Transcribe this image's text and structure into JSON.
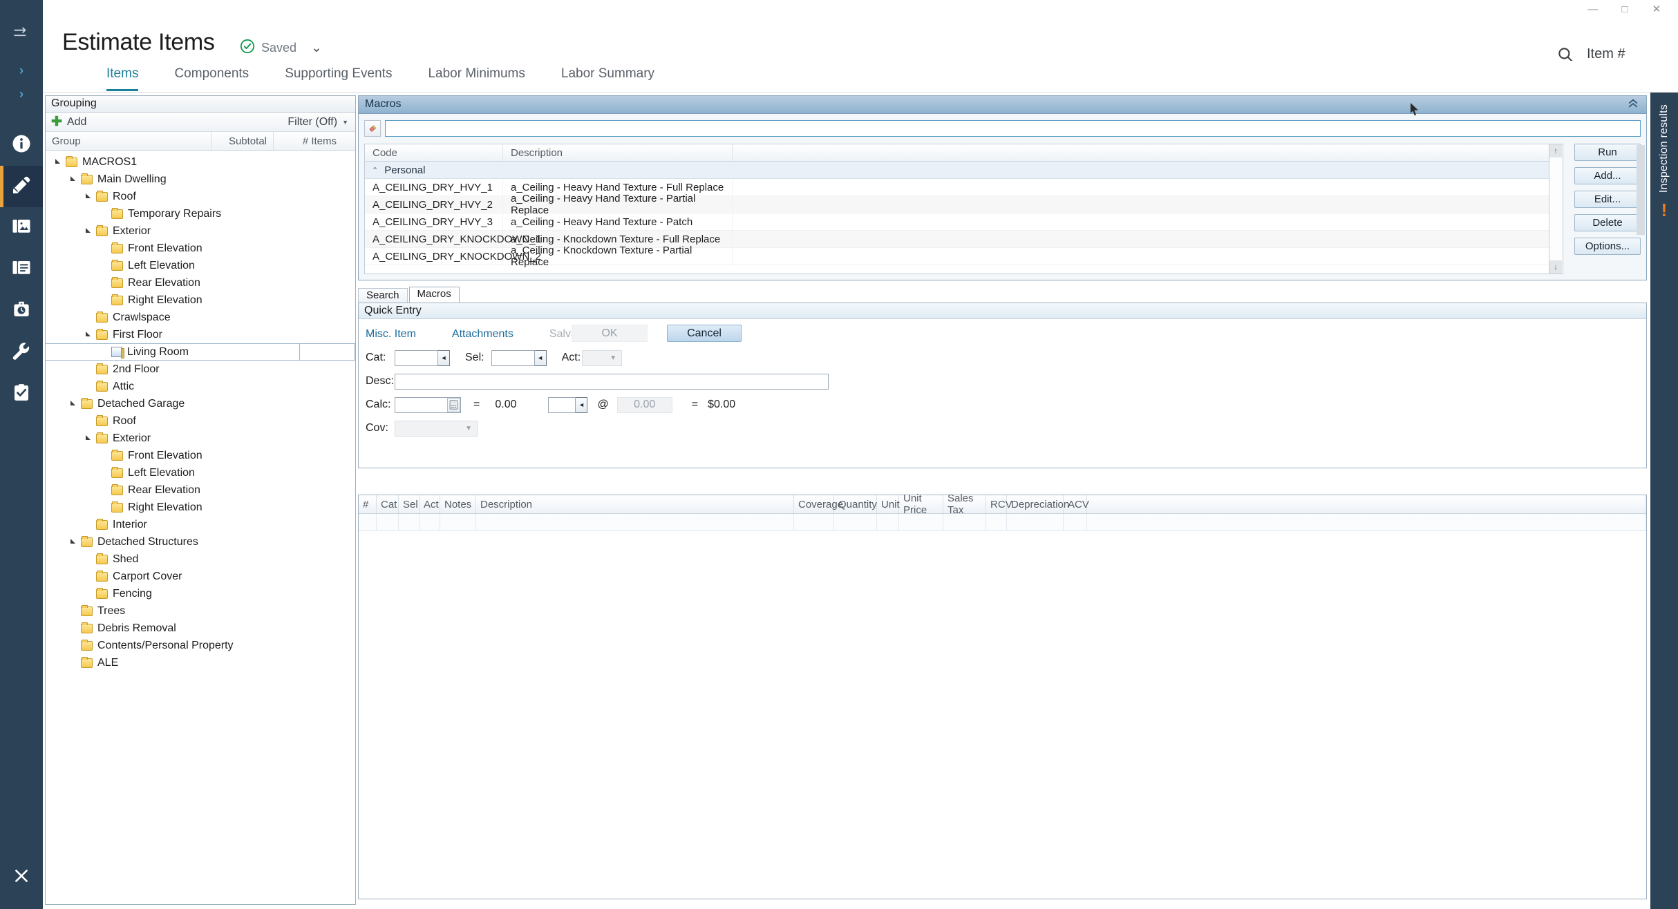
{
  "window": {
    "minimize": "—",
    "maximize": "□",
    "close": "✕"
  },
  "header": {
    "title": "Estimate Items",
    "saved_label": "Saved",
    "saved_icon": "check-circle-icon",
    "saved_chevron": "⌄",
    "search_icon": "search-icon",
    "search_value": "Item #"
  },
  "tabs": [
    {
      "label": "Items",
      "active": true
    },
    {
      "label": "Components",
      "active": false
    },
    {
      "label": "Supporting Events",
      "active": false
    },
    {
      "label": "Labor Minimums",
      "active": false
    },
    {
      "label": "Labor Summary",
      "active": false
    }
  ],
  "left_rail": {
    "toggle_icon": "collapse-nav-icon",
    "chevron_1": "›",
    "chevron_2": "›",
    "items": [
      {
        "name": "info-icon",
        "active": false
      },
      {
        "name": "estimate-pencil-icon",
        "active": true
      },
      {
        "name": "photos-icon",
        "active": false
      },
      {
        "name": "documents-icon",
        "active": false
      },
      {
        "name": "time-briefcase-icon",
        "active": false
      },
      {
        "name": "tools-wrench-icon",
        "active": false
      },
      {
        "name": "checklist-icon",
        "active": false
      }
    ],
    "close_icon": "✕"
  },
  "right_rail": {
    "expand_icon": "⇥",
    "label": "Inspection results",
    "alert_icon": "!"
  },
  "grouping": {
    "panel_title": "Grouping",
    "add_label": "Add",
    "add_icon": "plus-icon",
    "filter_label": "Filter (Off)",
    "filter_icon": "chevron-down-icon",
    "columns": [
      "Group",
      "Subtotal",
      "# Items"
    ],
    "tree": [
      {
        "label": "MACROS1",
        "depth": 0,
        "twist": "open",
        "icon": "folder",
        "selected": false
      },
      {
        "label": "Main Dwelling",
        "depth": 1,
        "twist": "open",
        "icon": "folder",
        "selected": false
      },
      {
        "label": "Roof",
        "depth": 2,
        "twist": "open",
        "icon": "folder",
        "selected": false
      },
      {
        "label": "Temporary Repairs",
        "depth": 3,
        "twist": "none",
        "icon": "folder",
        "selected": false
      },
      {
        "label": "Exterior",
        "depth": 2,
        "twist": "open",
        "icon": "folder",
        "selected": false
      },
      {
        "label": "Front Elevation",
        "depth": 3,
        "twist": "none",
        "icon": "folder",
        "selected": false
      },
      {
        "label": "Left Elevation",
        "depth": 3,
        "twist": "none",
        "icon": "folder",
        "selected": false
      },
      {
        "label": "Rear Elevation",
        "depth": 3,
        "twist": "none",
        "icon": "folder",
        "selected": false
      },
      {
        "label": "Right Elevation",
        "depth": 3,
        "twist": "none",
        "icon": "folder",
        "selected": false
      },
      {
        "label": "Crawlspace",
        "depth": 2,
        "twist": "none",
        "icon": "folder",
        "selected": false
      },
      {
        "label": "First Floor",
        "depth": 2,
        "twist": "open",
        "icon": "folder",
        "selected": false
      },
      {
        "label": "Living Room",
        "depth": 3,
        "twist": "none",
        "icon": "room",
        "selected": true
      },
      {
        "label": "2nd Floor",
        "depth": 2,
        "twist": "none",
        "icon": "folder",
        "selected": false
      },
      {
        "label": "Attic",
        "depth": 2,
        "twist": "none",
        "icon": "folder",
        "selected": false
      },
      {
        "label": "Detached Garage",
        "depth": 1,
        "twist": "open",
        "icon": "folder",
        "selected": false
      },
      {
        "label": "Roof",
        "depth": 2,
        "twist": "none",
        "icon": "folder",
        "selected": false
      },
      {
        "label": "Exterior",
        "depth": 2,
        "twist": "open",
        "icon": "folder",
        "selected": false
      },
      {
        "label": "Front Elevation",
        "depth": 3,
        "twist": "none",
        "icon": "folder",
        "selected": false
      },
      {
        "label": "Left Elevation",
        "depth": 3,
        "twist": "none",
        "icon": "folder",
        "selected": false
      },
      {
        "label": "Rear Elevation",
        "depth": 3,
        "twist": "none",
        "icon": "folder",
        "selected": false
      },
      {
        "label": "Right Elevation",
        "depth": 3,
        "twist": "none",
        "icon": "folder",
        "selected": false
      },
      {
        "label": "Interior",
        "depth": 2,
        "twist": "none",
        "icon": "folder",
        "selected": false
      },
      {
        "label": "Detached Structures",
        "depth": 1,
        "twist": "open",
        "icon": "folder",
        "selected": false
      },
      {
        "label": "Shed",
        "depth": 2,
        "twist": "none",
        "icon": "folder",
        "selected": false
      },
      {
        "label": "Carport Cover",
        "depth": 2,
        "twist": "none",
        "icon": "folder",
        "selected": false
      },
      {
        "label": "Fencing",
        "depth": 2,
        "twist": "none",
        "icon": "folder",
        "selected": false
      },
      {
        "label": "Trees",
        "depth": 1,
        "twist": "none",
        "icon": "folder",
        "selected": false
      },
      {
        "label": "Debris Removal",
        "depth": 1,
        "twist": "none",
        "icon": "folder",
        "selected": false
      },
      {
        "label": "Contents/Personal Property",
        "depth": 1,
        "twist": "none",
        "icon": "folder",
        "selected": false
      },
      {
        "label": "ALE",
        "depth": 1,
        "twist": "none",
        "icon": "folder",
        "selected": false
      }
    ]
  },
  "macros": {
    "panel_title": "Macros",
    "collapse_icon": "chevrons-up-icon",
    "eraser_icon": "eraser-icon",
    "search_value": "",
    "columns": [
      "Code",
      "Description",
      ""
    ],
    "group_label": "Personal",
    "group_chevron": "⌃",
    "rows": [
      {
        "code": "A_CEILING_DRY_HVY_1",
        "description": "a_Ceiling - Heavy Hand Texture - Full Replace"
      },
      {
        "code": "A_CEILING_DRY_HVY_2",
        "description": "a_Ceiling - Heavy Hand Texture - Partial Replace"
      },
      {
        "code": "A_CEILING_DRY_HVY_3",
        "description": "a_Ceiling - Heavy Hand Texture - Patch"
      },
      {
        "code": "A_CEILING_DRY_KNOCKDOWN_1",
        "description": "a_Ceiling - Knockdown Texture - Full Replace"
      },
      {
        "code": "A_CEILING_DRY_KNOCKDOWN_2",
        "description": "a_Ceiling - Knockdown Texture - Partial Replace"
      }
    ],
    "scroll_up_icon": "↑",
    "scroll_down_icon": "↓",
    "buttons": [
      "Run",
      "Add...",
      "Edit...",
      "Delete",
      "Options..."
    ]
  },
  "subtabs": [
    {
      "label": "Search",
      "active": false
    },
    {
      "label": "Macros",
      "active": true
    }
  ],
  "quick_entry": {
    "panel_title": "Quick Entry",
    "links": [
      {
        "label": "Misc. Item",
        "disabled": false
      },
      {
        "label": "Attachments",
        "disabled": false
      },
      {
        "label": "Salvage/Restored",
        "disabled": true
      }
    ],
    "ok_label": "OK",
    "cancel_label": "Cancel",
    "fields": {
      "cat_label": "Cat:",
      "cat_value": "",
      "sel_label": "Sel:",
      "sel_value": "",
      "act_label": "Act:",
      "act_value": "",
      "desc_label": "Desc:",
      "desc_value": "",
      "calc_label": "Calc:",
      "calc_value": "",
      "calc_icon": "calculator-icon",
      "eq1": "=",
      "result1": "0.00",
      "qty_value": "",
      "at_symbol": "@",
      "price_value": "0.00",
      "eq2": "=",
      "total": "$0.00",
      "cov_label": "Cov:",
      "cov_value": ""
    }
  },
  "items_grid": {
    "columns": [
      "#",
      "Cat",
      "Sel",
      "Act",
      "Notes",
      "Description",
      "Coverage",
      "Quantity",
      "Unit",
      "Unit Price",
      "Sales Tax",
      "RCV",
      "Depreciation",
      "ACV",
      ""
    ],
    "rows": []
  },
  "colors": {
    "rail_bg": "#2c4257",
    "rail_active": "#22344a",
    "accent_orange": "#e8a33d",
    "tab_active": "#1a7f99",
    "link_blue": "#1a6b99",
    "macros_header": "#8fb2cf"
  }
}
